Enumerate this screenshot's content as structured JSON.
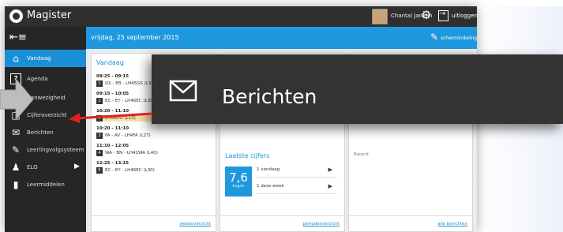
{
  "app": {
    "title": "Magister"
  },
  "user": {
    "name": "Chantal Janzen",
    "logout": "uitloggen"
  },
  "date_bar": {
    "date": "vrijdag, 25 september 2015",
    "action": "schermindeling"
  },
  "sidebar": {
    "menu_icon": "menu-icon",
    "items": [
      {
        "label": "Vandaag",
        "icon": "home-icon",
        "active": true
      },
      {
        "label": "Agenda",
        "icon": "calendar-icon",
        "calendar_day": "7"
      },
      {
        "label": "Aanwezigheid",
        "icon": "clock-icon"
      },
      {
        "label": "Cijferoverzicht",
        "icon": "grades-icon"
      },
      {
        "label": "Berichten",
        "icon": "envelope-icon"
      },
      {
        "label": "Leerlingvolgsysteem",
        "icon": "tracking-icon"
      },
      {
        "label": "ELO",
        "icon": "users-icon",
        "has_submenu": true
      },
      {
        "label": "Leermiddelen",
        "icon": "books-icon"
      }
    ]
  },
  "vandaag": {
    "title": "Vandaag",
    "lessons": [
      {
        "time": "08:25 - 09:15",
        "num": "1",
        "text": "GS - EB - LH45GS (L38)"
      },
      {
        "time": "09:15 - 10:05",
        "num": "2",
        "text": "EC - EY - LH46EC (L30)"
      },
      {
        "time": "10:20 - 11:10",
        "num": "3",
        "text": "LH0EDO (L12)"
      },
      {
        "time": "10:20 - 11:10",
        "num": "3",
        "text": "FA - AV - LH4FA (L27)"
      },
      {
        "time": "11:10 - 12:05",
        "num": "4",
        "text": "WA - BN - LH41WA (L40)"
      },
      {
        "time": "12:25 - 13:15",
        "num": "5",
        "text": "EC - EY - LH46EC (L30)"
      }
    ],
    "footer_link": "weekoverzicht"
  },
  "cijfers": {
    "title": "Laatste cijfers",
    "grade": "7,6",
    "grade_sub": "Engels",
    "rows": [
      "1 vandaag",
      "1 deze week"
    ],
    "footer_link": "periodeoverzicht"
  },
  "berichten_panel": {
    "label": "Recent",
    "footer_link": "alle berichten"
  },
  "zoom": {
    "label": "Berichten",
    "icon": "envelope-icon"
  },
  "colors": {
    "accent": "#1f98dd",
    "sidebar": "#262626",
    "topbar": "#2f2f2f",
    "popup": "#333333",
    "arrow": "#e02020"
  }
}
